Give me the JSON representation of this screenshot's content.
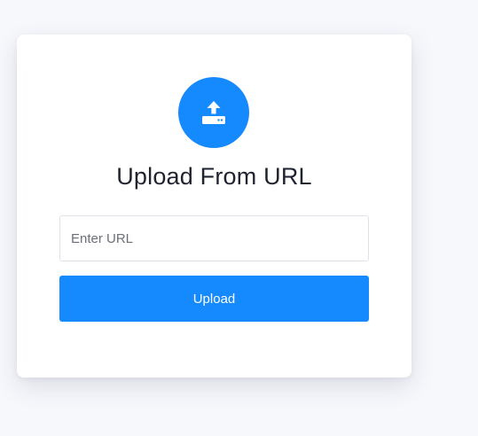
{
  "card": {
    "icon": "upload-tray-icon",
    "title": "Upload From URL",
    "url_input": {
      "placeholder": "Enter URL",
      "value": ""
    },
    "upload_button_label": "Upload"
  },
  "colors": {
    "accent": "#1589fe",
    "background": "#f7f8fc",
    "card": "#ffffff",
    "title_text": "#1f2330",
    "input_border": "#dfe2e8"
  }
}
